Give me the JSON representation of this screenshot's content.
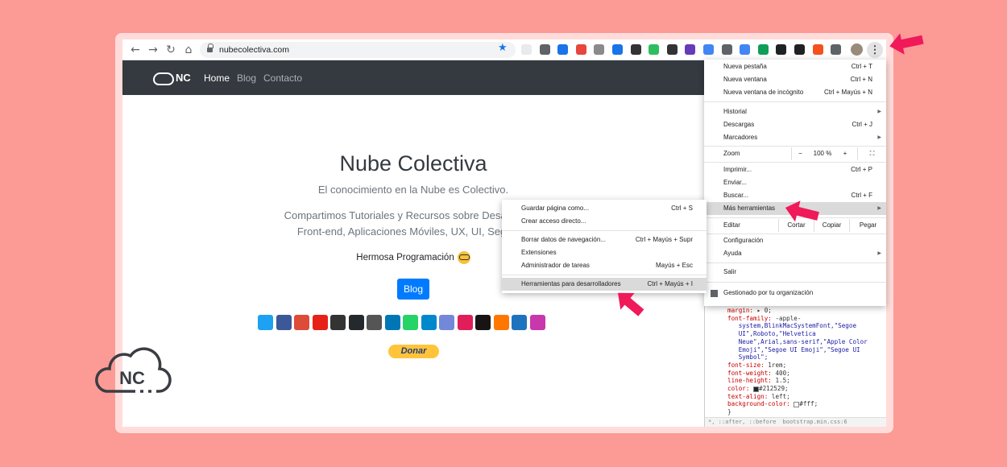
{
  "browser": {
    "url": "nubecolectiva.com",
    "nav": {
      "back": "←",
      "forward": "→",
      "reload": "↻",
      "home": "⌂"
    },
    "menu_button": "⋮",
    "extension_colors": [
      "#e8eaed",
      "#5f6368",
      "#1a73e8",
      "#e8453c",
      "#8a8a8a",
      "#1a73e8",
      "#333333",
      "#2dbe60",
      "#333333",
      "#673ab7",
      "#4285f4",
      "#5f6368",
      "#4285f4",
      "#0f9d58",
      "#202124",
      "#202124",
      "#f4511e",
      "#5f6368"
    ]
  },
  "site": {
    "logo_text": "NC",
    "nav": [
      {
        "label": "Home",
        "active": true
      },
      {
        "label": "Blog",
        "active": false
      },
      {
        "label": "Contacto",
        "active": false
      }
    ],
    "title": "Nube Colectiva",
    "subtitle": "El conocimiento en la Nube es Colectivo.",
    "description_line1": "Compartimos Tutoriales y Recursos sobre Desarrollo W",
    "description_line2": "Front-end, Aplicaciones Móviles, UX, UI, Segurida",
    "tagline": "Hermosa Programación",
    "blog_button": "Blog",
    "donate_button": "Donar",
    "social_icons": [
      {
        "name": "twitter-icon",
        "color": "#1da1f2"
      },
      {
        "name": "facebook-icon",
        "color": "#3b5998"
      },
      {
        "name": "google-plus-icon",
        "color": "#dd4b39"
      },
      {
        "name": "youtube-icon",
        "color": "#e62117"
      },
      {
        "name": "youtube-box-icon",
        "color": "#333333"
      },
      {
        "name": "github-icon",
        "color": "#24292e"
      },
      {
        "name": "instagram-icon",
        "color": "#555555"
      },
      {
        "name": "linkedin-icon",
        "color": "#0077b5"
      },
      {
        "name": "whatsapp-icon",
        "color": "#25d366"
      },
      {
        "name": "telegram-icon",
        "color": "#0088cc"
      },
      {
        "name": "discord-icon",
        "color": "#7289da"
      },
      {
        "name": "slack-icon",
        "color": "#e01e5a"
      },
      {
        "name": "spotify-icon",
        "color": "#191414"
      },
      {
        "name": "soundcloud-icon",
        "color": "#ff7700"
      },
      {
        "name": "handshake-icon",
        "color": "#1e73be"
      },
      {
        "name": "hands-icon",
        "color": "#c837ab"
      }
    ]
  },
  "chrome_menu": {
    "new_tab": {
      "label": "Nueva pestaña",
      "shortcut": "Ctrl + T"
    },
    "new_window": {
      "label": "Nueva ventana",
      "shortcut": "Ctrl + N"
    },
    "incognito": {
      "label": "Nueva ventana de incógnito",
      "shortcut": "Ctrl + Mayús + N"
    },
    "history": {
      "label": "Historial"
    },
    "downloads": {
      "label": "Descargas",
      "shortcut": "Ctrl + J"
    },
    "bookmarks": {
      "label": "Marcadores"
    },
    "zoom": {
      "label": "Zoom",
      "minus": "−",
      "value": "100 %",
      "plus": "+",
      "fullscreen": "⛶"
    },
    "print": {
      "label": "Imprimir...",
      "shortcut": "Ctrl + P"
    },
    "cast": {
      "label": "Enviar..."
    },
    "find": {
      "label": "Buscar...",
      "shortcut": "Ctrl + F"
    },
    "more_tools": {
      "label": "Más herramientas"
    },
    "edit": {
      "label": "Editar",
      "cut": "Cortar",
      "copy": "Copiar",
      "paste": "Pegar"
    },
    "settings": {
      "label": "Configuración"
    },
    "help": {
      "label": "Ayuda"
    },
    "exit": {
      "label": "Salir"
    },
    "managed": {
      "label": "Gestionado por tu organización"
    }
  },
  "submenu": {
    "save_page": {
      "label": "Guardar página como...",
      "shortcut": "Ctrl + S"
    },
    "create_shortcut": {
      "label": "Crear acceso directo..."
    },
    "clear_data": {
      "label": "Borrar datos de navegación...",
      "shortcut": "Ctrl + Mayús + Supr"
    },
    "extensions": {
      "label": "Extensiones"
    },
    "task_manager": {
      "label": "Administrador de tareas",
      "shortcut": "Mayús + Esc"
    },
    "dev_tools": {
      "label": "Herramientas para desarrolladores",
      "shortcut": "Ctrl + Mayús + I"
    }
  },
  "devtools": {
    "lines": [
      {
        "prop": "margin:",
        "val": "▸ 0;"
      },
      {
        "prop": "font-family:",
        "val": "-apple-"
      },
      {
        "prop": "",
        "val": "   system,BlinkMacSystemFont,\"Segoe"
      },
      {
        "prop": "",
        "val": "   UI\",Roboto,\"Helvetica"
      },
      {
        "prop": "",
        "val": "   Neue\",Arial,sans-serif,\"Apple Color"
      },
      {
        "prop": "",
        "val": "   Emoji\",\"Segoe UI Emoji\",\"Segoe UI"
      },
      {
        "prop": "",
        "val": "   Symbol\";"
      },
      {
        "prop": "font-size:",
        "val": "1rem;"
      },
      {
        "prop": "font-weight:",
        "val": "400;"
      },
      {
        "prop": "line-height:",
        "val": "1.5;"
      },
      {
        "prop": "color:",
        "val": "#212529;"
      },
      {
        "prop": "text-align:",
        "val": "left;"
      },
      {
        "prop": "background-color:",
        "val": "#fff;"
      }
    ],
    "closing_brace": "}",
    "footer_selector": "*, ::after, ::before",
    "footer_source": "bootstrap.min.css:6"
  },
  "watermark": {
    "text": "NC"
  },
  "colors": {
    "accent_arrow": "#f0195a",
    "menu_highlight": "#dadada"
  }
}
